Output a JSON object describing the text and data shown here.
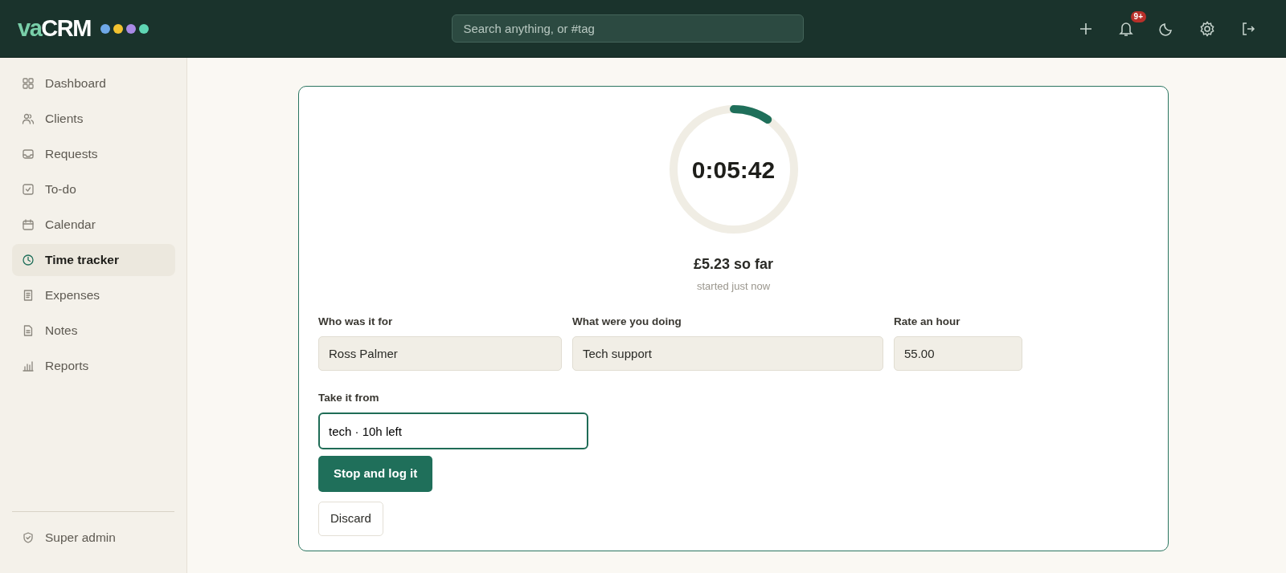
{
  "header": {
    "logo": {
      "primary": "va",
      "secondary": "CRM",
      "dots": [
        {
          "color": "#6fa8e8"
        },
        {
          "color": "#f2c230"
        },
        {
          "color": "#a98ae6"
        },
        {
          "color": "#5fd6b4"
        }
      ]
    },
    "search": {
      "placeholder": "Search anything, or #tag"
    },
    "notifications_badge": "9+"
  },
  "sidebar": {
    "items": [
      {
        "label": "Dashboard",
        "selected": false
      },
      {
        "label": "Clients",
        "selected": false
      },
      {
        "label": "Requests",
        "selected": false
      },
      {
        "label": "To-do",
        "selected": false
      },
      {
        "label": "Calendar",
        "selected": false
      },
      {
        "label": "Time tracker",
        "selected": true
      },
      {
        "label": "Expenses",
        "selected": false
      },
      {
        "label": "Notes",
        "selected": false
      },
      {
        "label": "Reports",
        "selected": false
      }
    ],
    "footer": {
      "label": "Super admin"
    }
  },
  "timer": {
    "time": "0:05:42",
    "level": 0.095,
    "earned": "£5.23 so far",
    "started": "started just now"
  },
  "fields": [
    {
      "label": "Who was it for",
      "value": "Ross Palmer"
    },
    {
      "label": "What were you doing",
      "value": "Tech support"
    },
    {
      "label": "Rate an hour",
      "value": "55.00"
    }
  ],
  "source": {
    "label": "Take it from",
    "value": "tech · 10h left"
  },
  "buttons": [
    {
      "label": "Stop and log it",
      "kind": "primary"
    },
    {
      "label": "Discard",
      "kind": "secondary"
    }
  ]
}
